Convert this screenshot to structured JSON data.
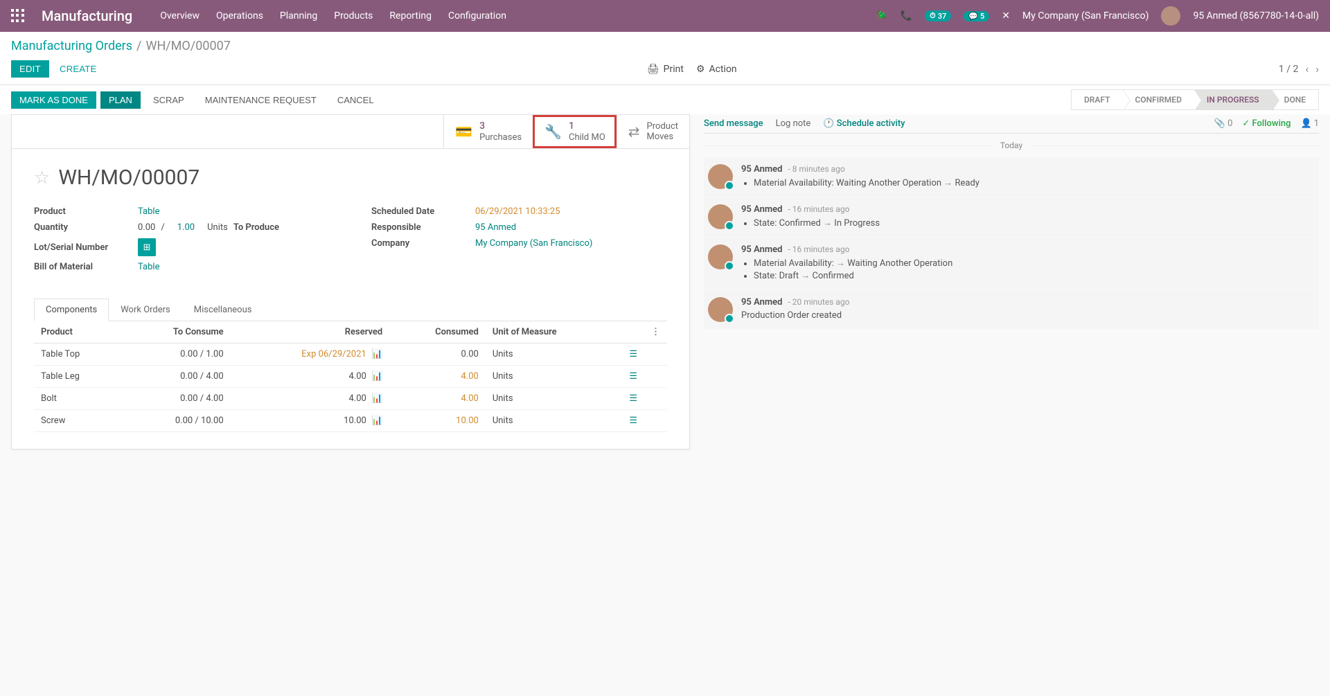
{
  "topbar": {
    "brand": "Manufacturing",
    "nav": [
      "Overview",
      "Operations",
      "Planning",
      "Products",
      "Reporting",
      "Configuration"
    ],
    "clock_badge": "37",
    "chat_badge": "5",
    "company": "My Company (San Francisco)",
    "user": "95 Anmed (8567780-14-0-all)"
  },
  "breadcrumb": {
    "root": "Manufacturing Orders",
    "current": "WH/MO/00007"
  },
  "buttons": {
    "edit": "EDIT",
    "create": "CREATE",
    "print": "Print",
    "action": "Action",
    "mark_done": "MARK AS DONE",
    "plan": "PLAN",
    "scrap": "SCRAP",
    "maint": "MAINTENANCE REQUEST",
    "cancel": "CANCEL"
  },
  "pager": {
    "text": "1 / 2"
  },
  "status_steps": [
    "DRAFT",
    "CONFIRMED",
    "IN PROGRESS",
    "DONE"
  ],
  "stat_buttons": {
    "purchases": {
      "count": "3",
      "label": "Purchases"
    },
    "child_mo": {
      "count": "1",
      "label": "Child MO"
    },
    "product_moves": {
      "line1": "Product",
      "line2": "Moves"
    }
  },
  "record": {
    "name": "WH/MO/00007",
    "product_label": "Product",
    "product": "Table",
    "qty_label": "Quantity",
    "qty_done": "0.00",
    "qty_sep": "/",
    "qty_target": "1.00",
    "qty_uom": "Units",
    "qty_suffix": "To Produce",
    "lot_label": "Lot/Serial Number",
    "bom_label": "Bill of Material",
    "bom": "Table",
    "sched_label": "Scheduled Date",
    "sched": "06/29/2021 10:33:25",
    "resp_label": "Responsible",
    "resp": "95 Anmed",
    "company_label": "Company",
    "company": "My Company (San Francisco)"
  },
  "tabs": [
    "Components",
    "Work Orders",
    "Miscellaneous"
  ],
  "components": {
    "headers": {
      "product": "Product",
      "to_consume": "To Consume",
      "reserved": "Reserved",
      "consumed": "Consumed",
      "uom": "Unit of Measure"
    },
    "rows": [
      {
        "product": "Table Top",
        "to_consume": "0.00 / 1.00",
        "reserved": "Exp 06/29/2021",
        "reserved_warn": true,
        "consumed": "0.00",
        "consumed_edit": false,
        "uom": "Units"
      },
      {
        "product": "Table Leg",
        "to_consume": "0.00 / 4.00",
        "reserved": "4.00",
        "reserved_warn": false,
        "consumed": "4.00",
        "consumed_edit": true,
        "uom": "Units"
      },
      {
        "product": "Bolt",
        "to_consume": "0.00 / 4.00",
        "reserved": "4.00",
        "reserved_warn": false,
        "consumed": "4.00",
        "consumed_edit": true,
        "uom": "Units"
      },
      {
        "product": "Screw",
        "to_consume": "0.00 / 10.00",
        "reserved": "10.00",
        "reserved_warn": false,
        "consumed": "10.00",
        "consumed_edit": true,
        "uom": "Units"
      }
    ]
  },
  "chatter": {
    "send": "Send message",
    "log": "Log note",
    "schedule": "Schedule activity",
    "attachments": "0",
    "following": "Following",
    "followers": "1",
    "today": "Today",
    "messages": [
      {
        "author": "95 Anmed",
        "time": "- 8 minutes ago",
        "lines": [
          "Material Availability: Waiting Another Operation → Ready"
        ]
      },
      {
        "author": "95 Anmed",
        "time": "- 16 minutes ago",
        "lines": [
          "State: Confirmed → In Progress"
        ]
      },
      {
        "author": "95 Anmed",
        "time": "- 16 minutes ago",
        "lines": [
          "Material Availability: → Waiting Another Operation",
          "State: Draft → Confirmed"
        ]
      },
      {
        "author": "95 Anmed",
        "time": "- 20 minutes ago",
        "plain": "Production Order created"
      }
    ]
  }
}
